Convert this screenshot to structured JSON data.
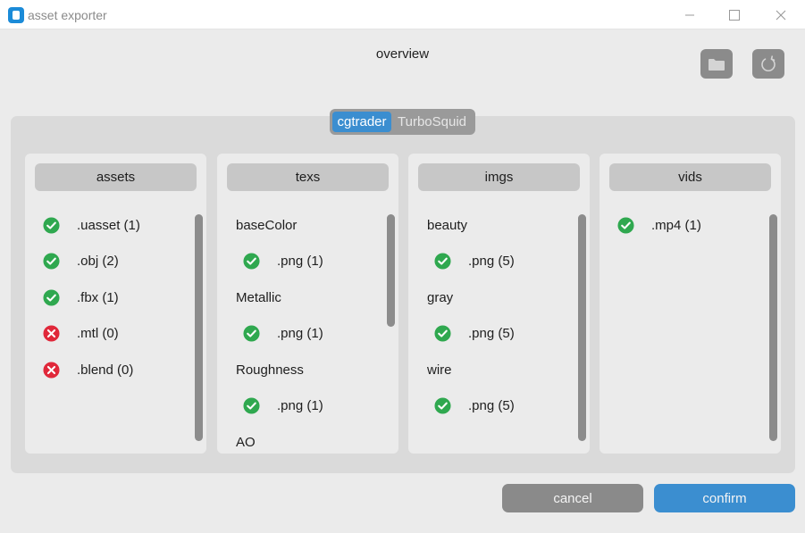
{
  "window": {
    "title": "asset exporter"
  },
  "header": {
    "title": "overview"
  },
  "tabs": [
    {
      "label": "cgtrader",
      "active": true
    },
    {
      "label": "TurboSquid",
      "active": false
    }
  ],
  "columns": [
    {
      "header": "assets",
      "rows": [
        {
          "kind": "item",
          "status": "ok",
          "label": ".uasset (1)"
        },
        {
          "kind": "item",
          "status": "missing",
          "label": ".obj (2)"
        },
        {
          "kind": "item",
          "status": "ok",
          "label": ".fbx (1)"
        },
        {
          "kind": "item",
          "status": "missing",
          "label": ".mtl (0)"
        },
        {
          "kind": "item",
          "status": "missing",
          "label": ".blend (0)"
        }
      ]
    },
    {
      "header": "texs",
      "rows": [
        {
          "kind": "heading",
          "label": "baseColor"
        },
        {
          "kind": "sub",
          "status": "ok",
          "label": ".png (1)"
        },
        {
          "kind": "heading",
          "label": "Metallic"
        },
        {
          "kind": "sub",
          "status": "ok",
          "label": ".png (1)"
        },
        {
          "kind": "heading",
          "label": "Roughness"
        },
        {
          "kind": "sub",
          "status": "ok",
          "label": ".png (1)"
        },
        {
          "kind": "heading",
          "label": "AO"
        }
      ]
    },
    {
      "header": "imgs",
      "rows": [
        {
          "kind": "heading",
          "label": "beauty"
        },
        {
          "kind": "sub",
          "status": "ok",
          "label": ".png (5)"
        },
        {
          "kind": "heading",
          "label": "gray"
        },
        {
          "kind": "sub",
          "status": "ok",
          "label": ".png (5)"
        },
        {
          "kind": "heading",
          "label": "wire"
        },
        {
          "kind": "sub",
          "status": "ok",
          "label": ".png (5)"
        }
      ]
    },
    {
      "header": "vids",
      "rows": [
        {
          "kind": "item",
          "status": "ok",
          "label": ".mp4 (1)"
        }
      ]
    }
  ],
  "actions": {
    "cancel": "cancel",
    "confirm": "confirm"
  },
  "colors": {
    "accent": "#3b8ed0",
    "ok": "#2fa84f",
    "missing": "#e0283a",
    "neutral_button": "#8a8a8a"
  },
  "icons": {
    "app": "app-logo-icon",
    "folder": "folder-icon",
    "refresh": "refresh-icon",
    "ok": "check-circle-icon",
    "missing": "x-circle-icon"
  }
}
